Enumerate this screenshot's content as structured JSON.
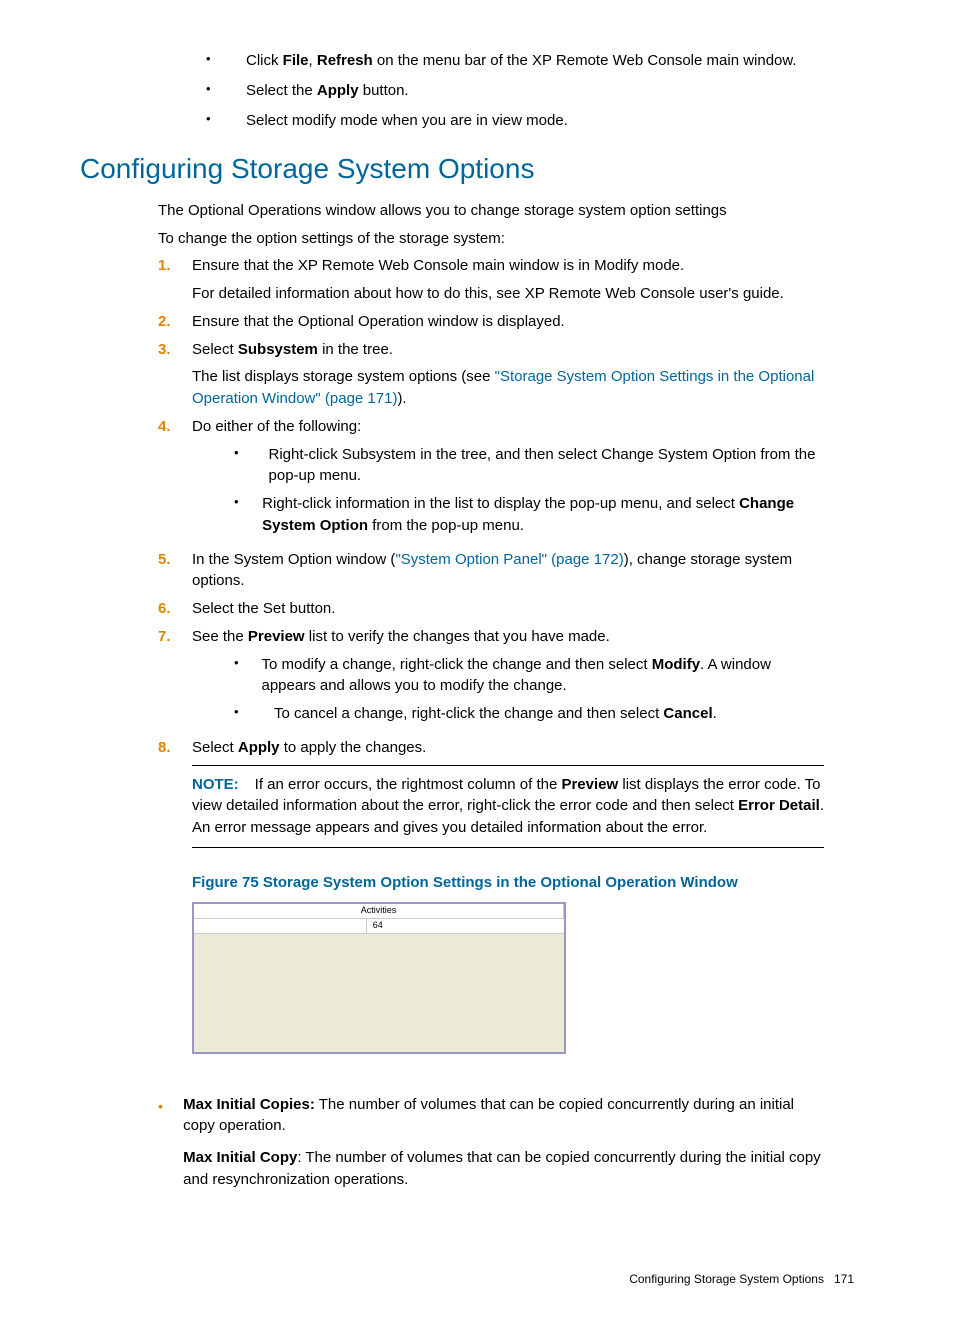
{
  "topBullets": {
    "b1_pre": "Click ",
    "b1_bold1": "File",
    "b1_mid": ", ",
    "b1_bold2": "Refresh",
    "b1_post": " on the menu bar of the XP Remote Web Console main window.",
    "b2_pre": "Select the ",
    "b2_bold": "Apply",
    "b2_post": " button.",
    "b3": "Select modify mode when you are in view mode."
  },
  "heading": "Configuring Storage System Options",
  "intro1": "The Optional Operations window allows you to change storage system option settings",
  "intro2": "To change the option settings of the storage system:",
  "steps": {
    "s1": {
      "num": "1.",
      "line1": "Ensure that the XP Remote Web Console main window is in Modify mode.",
      "line2": "For detailed information about how to do this, see XP Remote Web Console user's guide."
    },
    "s2": {
      "num": "2.",
      "text": "Ensure that the Optional Operation window is displayed."
    },
    "s3": {
      "num": "3.",
      "pre": "Select ",
      "bold": "Subsystem",
      "post": " in the tree.",
      "line2_pre": "The list displays storage system options (see ",
      "line2_link": "\"Storage System Option Settings in the Optional Operation Window\" (page 171)",
      "line2_post": ")."
    },
    "s4": {
      "num": "4.",
      "text": "Do either of the following:",
      "sub1": "Right-click Subsystem in the tree, and then select Change System Option from the pop-up menu.",
      "sub2_pre": "Right-click information in the list to display the pop-up menu, and select ",
      "sub2_bold": "Change System Option",
      "sub2_post": " from the pop-up menu."
    },
    "s5": {
      "num": "5.",
      "pre": "In the System Option window (",
      "link": "\"System Option Panel\" (page 172)",
      "post": "), change storage system options."
    },
    "s6": {
      "num": "6.",
      "text": "Select the Set button."
    },
    "s7": {
      "num": "7.",
      "pre": "See the ",
      "bold": "Preview",
      "post": " list to verify the changes that you have made.",
      "sub1_pre": "To modify a change, right-click the change and then select ",
      "sub1_bold": "Modify",
      "sub1_post": ". A window appears and allows you to modify the change.",
      "sub2_pre": "To cancel a change, right-click the change and then select ",
      "sub2_bold": "Cancel",
      "sub2_post": "."
    },
    "s8": {
      "num": "8.",
      "pre": "Select ",
      "bold": "Apply",
      "post": " to apply the changes."
    }
  },
  "note": {
    "label": "NOTE:",
    "t1": "If an error occurs, the rightmost column of the ",
    "b1": "Preview",
    "t2": " list displays the error code. To view detailed information about the error, right-click the error code and then select ",
    "b2": "Error Detail",
    "t3": ". An error message appears and gives you detailed information about the error."
  },
  "figureCaption": "Figure 75 Storage System Option Settings in the Optional Operation Window",
  "figureTable": {
    "header": "Activities",
    "cell": "64"
  },
  "bottom": {
    "b1_bold": "Max Initial Copies:",
    "b1_text": " The number of volumes that can be copied concurrently during an initial copy operation.",
    "p2_bold": "Max Initial Copy",
    "p2_text": ": The number of volumes that can be copied concurrently during the initial copy and resynchronization operations."
  },
  "footer": {
    "text": "Configuring Storage System Options",
    "page": "171"
  }
}
